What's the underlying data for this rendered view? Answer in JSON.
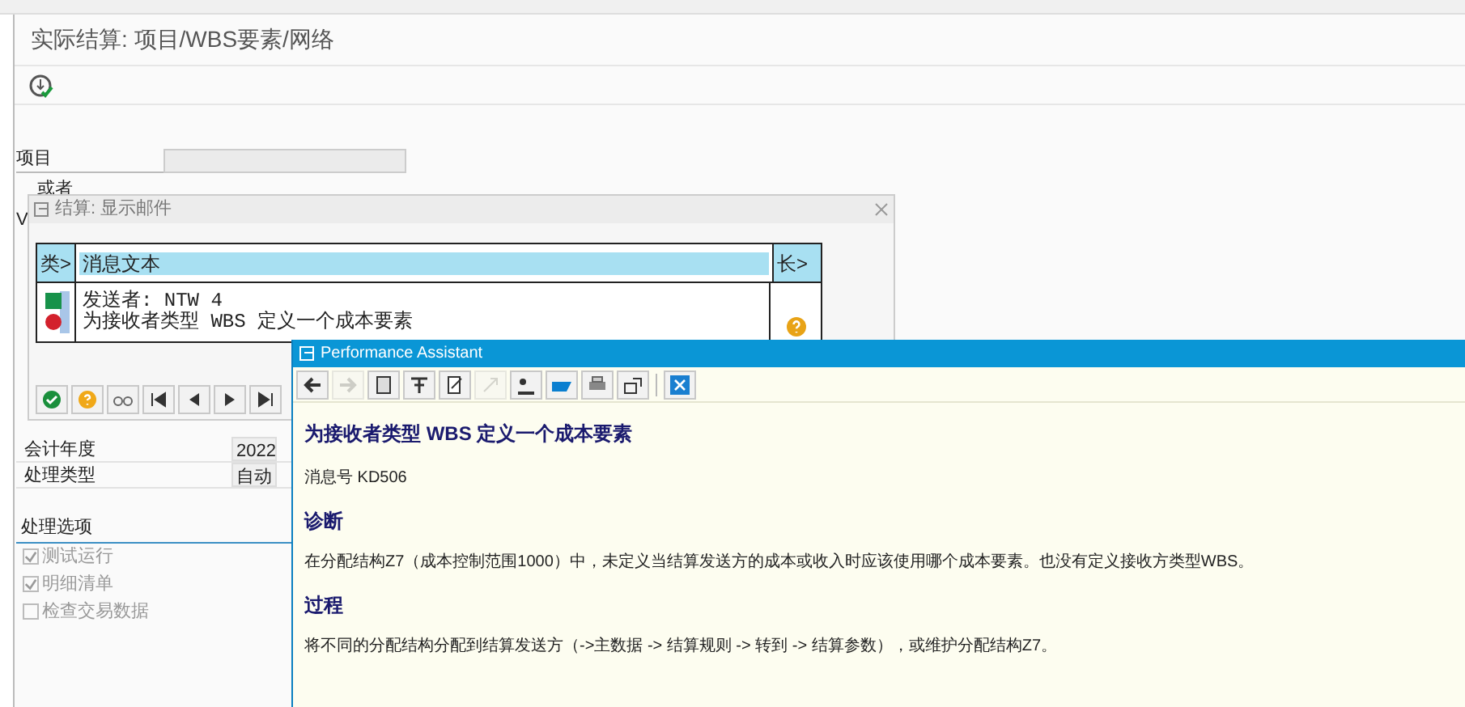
{
  "window": {
    "title": "实际结算: 项目/WBS要素/网络"
  },
  "form": {
    "fields": [
      {
        "label": "项目"
      }
    ],
    "or_label": "或者",
    "cut_labels": [
      "V"
    ]
  },
  "period": {
    "rows": [
      {
        "label": "会计年度",
        "value": "2022"
      },
      {
        "label": "处理类型",
        "value": "自动"
      }
    ]
  },
  "options": {
    "title": "处理选项",
    "items": [
      {
        "label": "测试运行",
        "checked": true,
        "disabled": true
      },
      {
        "label": "明细清单",
        "checked": true,
        "disabled": true
      },
      {
        "label": "检查交易数据",
        "checked": false,
        "disabled": true
      }
    ]
  },
  "mail_dialog": {
    "title": "结算: 显示邮件",
    "columns": [
      "类>",
      "消息文本",
      "长>"
    ],
    "rows": [
      {
        "lines": [
          "发送者: NTW 4",
          "为接收者类型 WBS 定义一个成本要素"
        ],
        "color": "#d3212c",
        "has_help": true
      }
    ]
  },
  "assistant": {
    "title": "Performance Assistant",
    "heading": "为接收者类型 WBS 定义一个成本要素",
    "message_no": "消息号 KD506",
    "sections": [
      {
        "title": "诊断",
        "text": "在分配结构Z7（成本控制范围1000）中，未定义当结算发送方的成本或收入时应该使用哪个成本要素。也没有定义接收方类型WBS。"
      },
      {
        "title": "过程",
        "text": "将不同的分配结构分配到结算发送方（->主数据 -> 结算规则 -> 转到 -> 结算参数），或维护分配结构Z7。"
      }
    ]
  }
}
